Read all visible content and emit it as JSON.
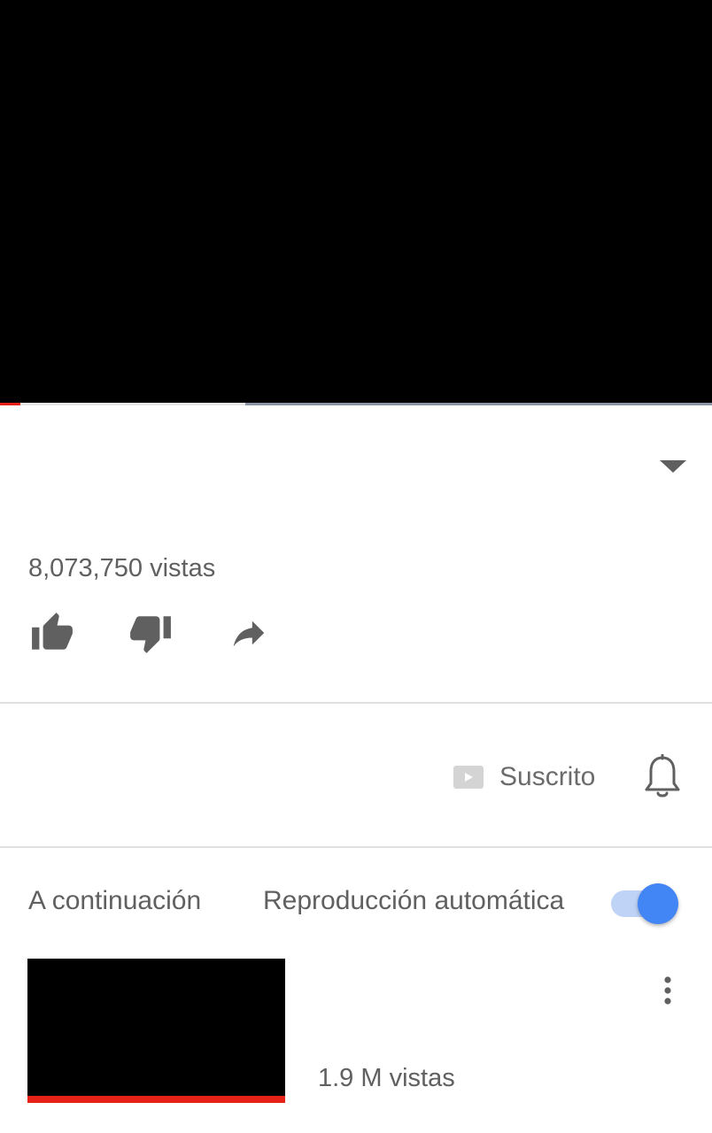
{
  "player": {
    "progress_fraction": 0.028,
    "buffer_start_fraction": 0.345,
    "buffer_end_fraction": 1.0
  },
  "video_info": {
    "expand_icon": "chevron-down-icon",
    "views": "8,073,750 vistas"
  },
  "actions": [
    {
      "name": "like-button",
      "icon": "thumbs-up-icon"
    },
    {
      "name": "dislike-button",
      "icon": "thumbs-down-icon"
    },
    {
      "name": "share-button",
      "icon": "share-icon"
    }
  ],
  "channel": {
    "subscribe_label": "Suscrito",
    "subscribe_icon": "youtube-play-icon",
    "notification_icon": "bell-icon"
  },
  "up_next": {
    "label": "A continuación",
    "autoplay_label": "Reproducción automática",
    "autoplay_on": true,
    "items": [
      {
        "views": "1.9 M vistas",
        "watched_fraction": 1.0,
        "menu_icon": "more-vert-icon"
      }
    ]
  },
  "colors": {
    "accent_red": "#e62117",
    "toggle_blue": "#4285f4",
    "text_gray": "#606060",
    "icon_gray": "#606060"
  }
}
